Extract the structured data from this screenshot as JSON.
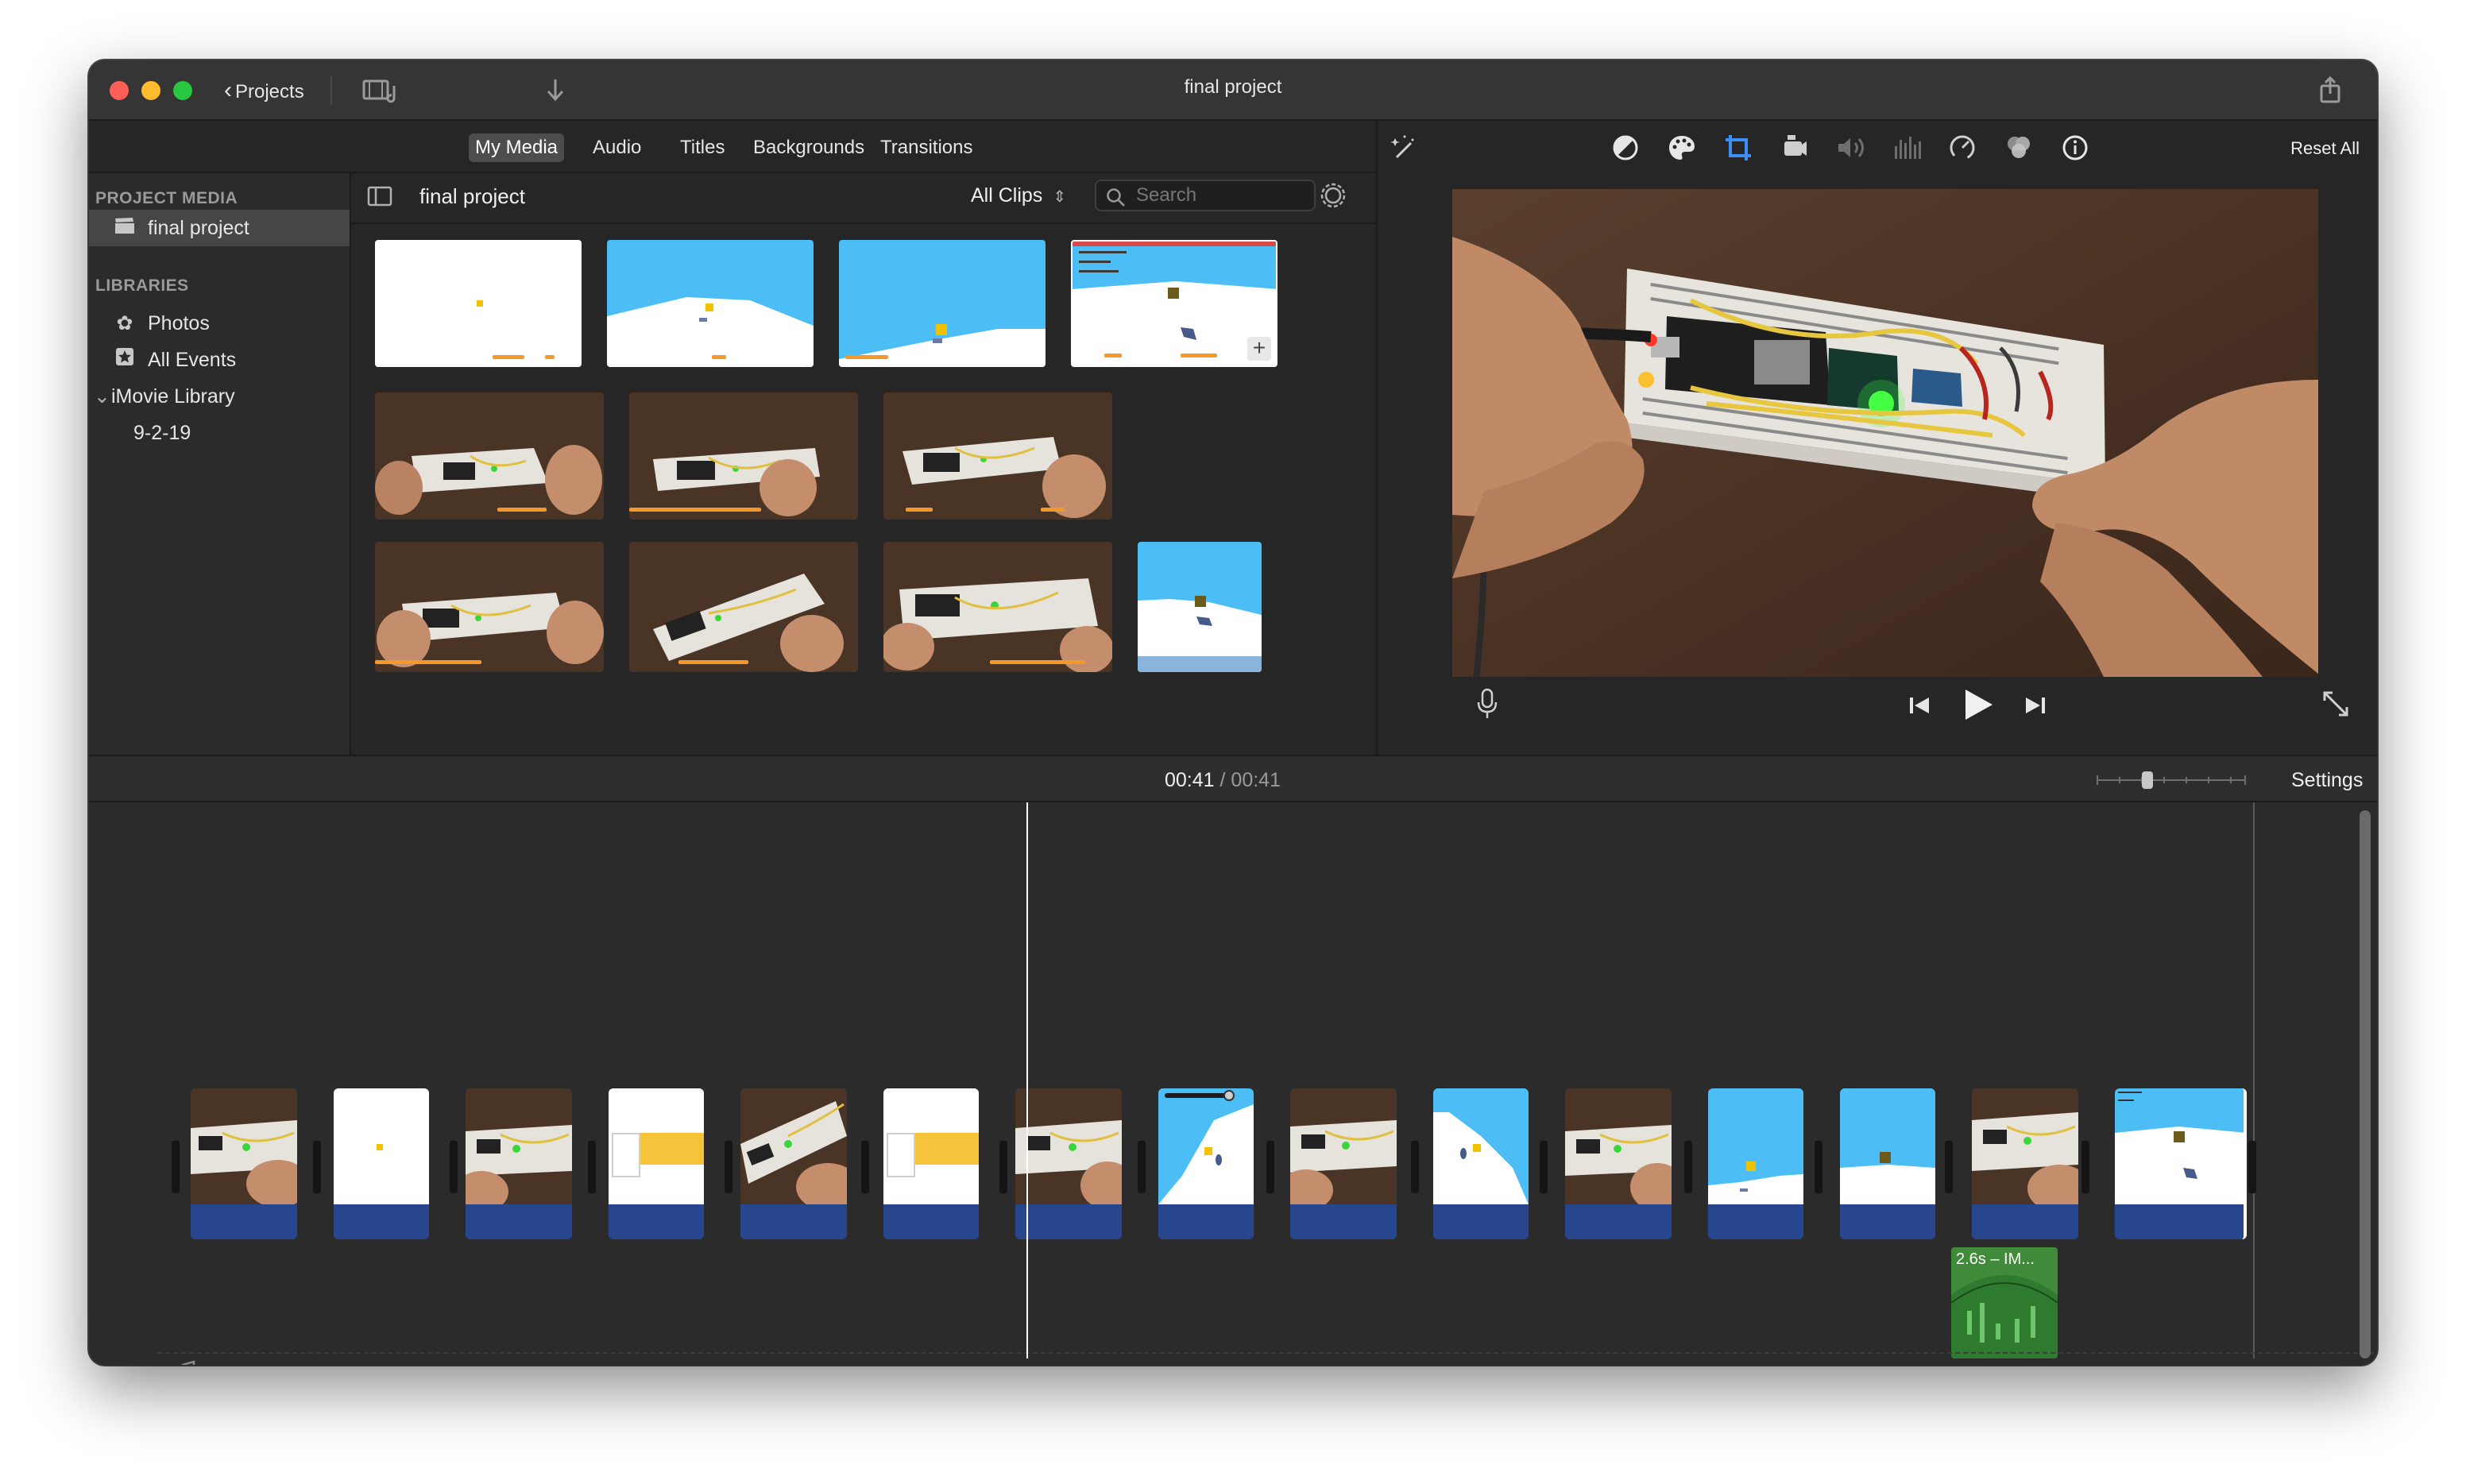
{
  "window": {
    "title": "final project",
    "projects_label": "Projects"
  },
  "browser": {
    "tabs": [
      "My Media",
      "Audio",
      "Titles",
      "Backgrounds",
      "Transitions"
    ],
    "active_tab": "My Media",
    "header_title": "final project",
    "clip_filter": "All Clips",
    "search_placeholder": "Search"
  },
  "sidebar": {
    "project_media_header": "PROJECT MEDIA",
    "project_item": "final project",
    "libraries_header": "LIBRARIES",
    "items": [
      "Photos",
      "All Events",
      "iMovie Library",
      "9-2-19"
    ]
  },
  "viewer": {
    "reset_label": "Reset All",
    "active_tool": "crop"
  },
  "timeline": {
    "current_time": "00:41",
    "separator": "/",
    "total_time": "00:41",
    "settings_label": "Settings",
    "audio_clip_label": "2.6s – IM..."
  },
  "colors": {
    "accent_blue": "#3b8ff7",
    "clip_audio_blue": "#27468e",
    "audio_green": "#3f8b3a",
    "progress_orange": "#f5982a",
    "sky_blue": "#4cbdf5"
  }
}
